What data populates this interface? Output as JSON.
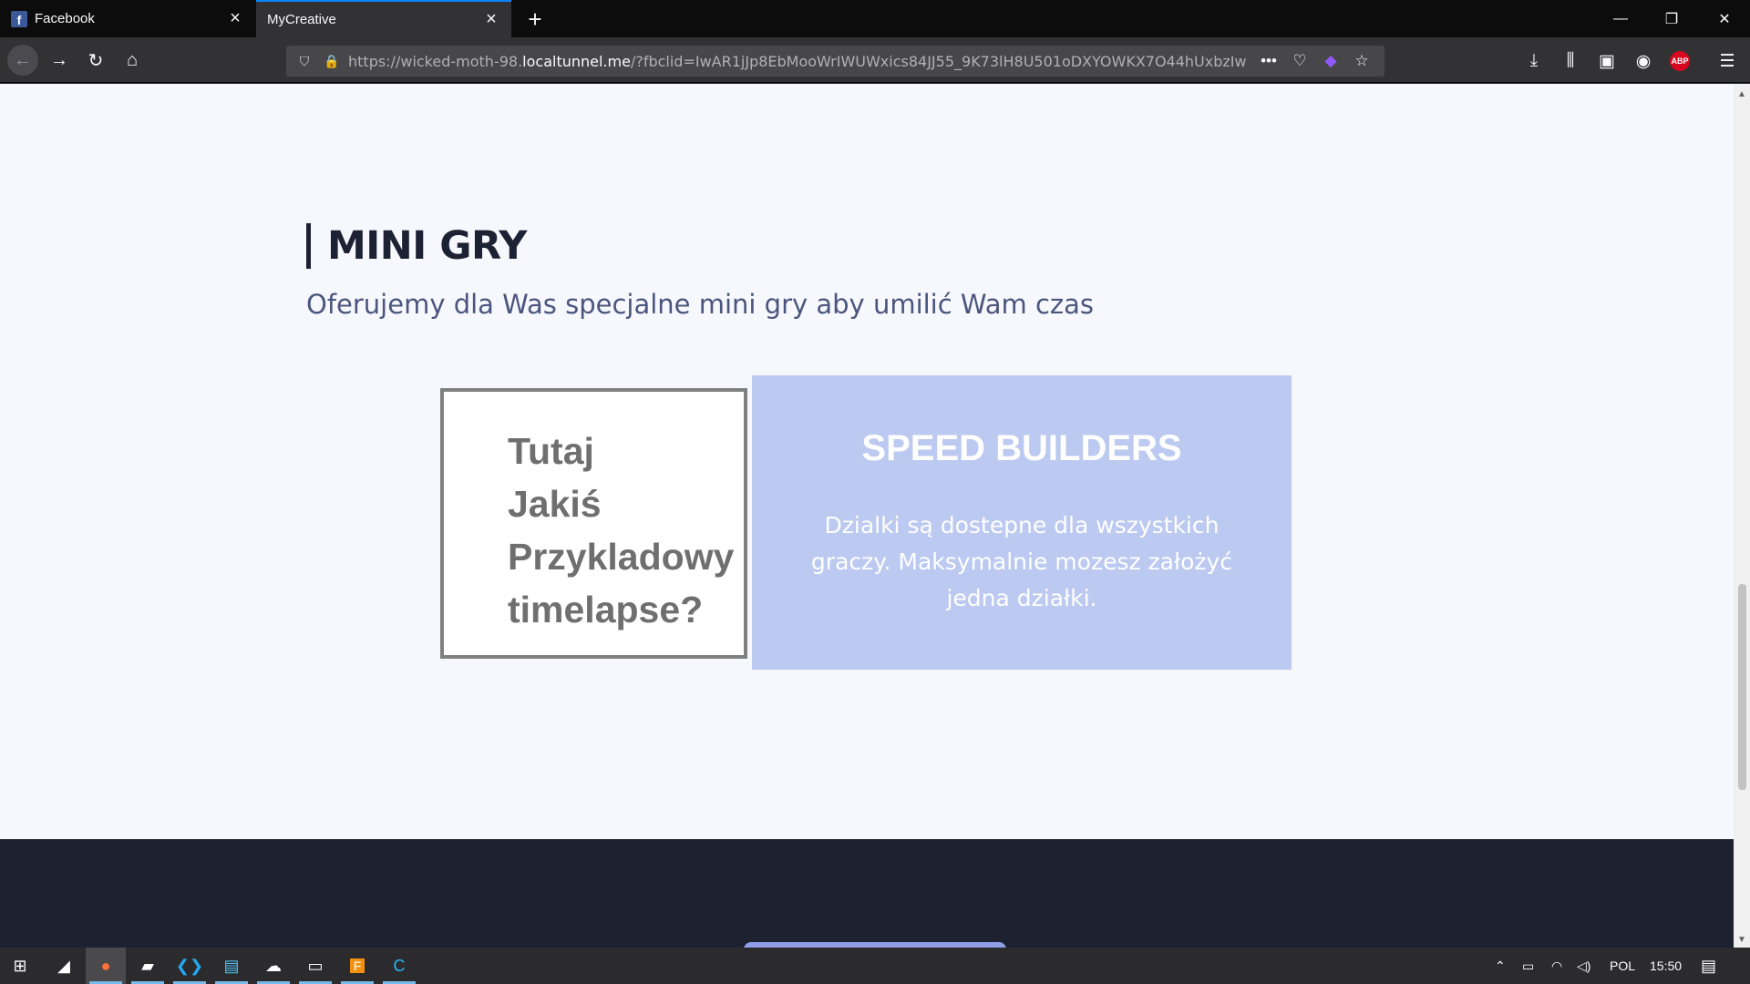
{
  "browser": {
    "tabs": [
      {
        "title": "Facebook",
        "icon": "facebook-icon",
        "active": false
      },
      {
        "title": "MyCreative",
        "icon": "",
        "active": true
      }
    ],
    "url": {
      "prefix": "https://wicked-moth-98.",
      "host": "localtunnel.me",
      "suffix": "/?fbclid=IwAR1jJp8EbMooWrIWUWxics84JJ55_9K73lH8U501oDXYOWKX7O44hUxbzIw"
    },
    "accent_color": "#0a84ff"
  },
  "page": {
    "section_title": "MINI GRY",
    "section_subtitle": "Oferujemy dla Was specjalne mini gry aby umilić Wam czas",
    "timelapse_placeholder": [
      "Tutaj",
      "Jakiś",
      "Przykladowy",
      "timelapse?"
    ],
    "card": {
      "title": "SPEED BUILDERS",
      "description": "Dzialki są dostepne dla wszystkich graczy. Maksymalnie mozesz założyć jedna działki.",
      "background": "#bcc9f0"
    }
  },
  "taskbar": {
    "apps": [
      "windows-start-icon",
      "app-1-icon",
      "firefox-icon",
      "app-3-icon",
      "vscode-icon",
      "app-5-icon",
      "app-6-icon",
      "terminal-icon",
      "app-8-icon",
      "app-9-icon"
    ],
    "language": "POL",
    "time": "15:50"
  }
}
